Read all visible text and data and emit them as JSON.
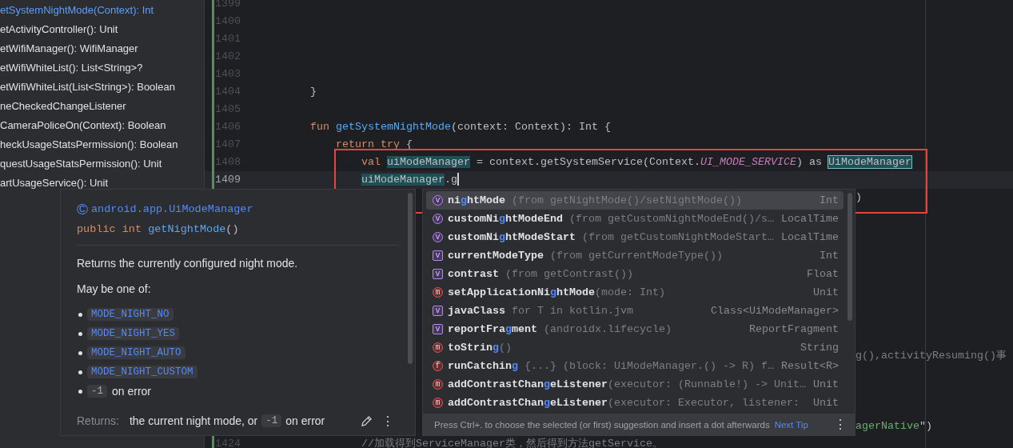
{
  "structure": {
    "items": [
      {
        "label": "etSystemNightMode(Context): Int",
        "selected": true
      },
      {
        "label": "etActivityController(): Unit",
        "selected": false
      },
      {
        "label": "etWifiManager(): WifiManager",
        "selected": false
      },
      {
        "label": "etWifiWhiteList(): List<String>?",
        "selected": false
      },
      {
        "label": "etWifiWhiteList(List<String>): Boolean",
        "selected": false
      },
      {
        "label": "neCheckedChangeListener",
        "selected": false
      },
      {
        "label": "CameraPoliceOn(Context): Boolean",
        "selected": false
      },
      {
        "label": "heckUsageStatsPermission(): Boolean",
        "selected": false
      },
      {
        "label": "questUsageStatsPermission(): Unit",
        "selected": false
      },
      {
        "label": "artUsageService(): Unit",
        "selected": false
      }
    ]
  },
  "editor": {
    "lines": [
      {
        "kind": "member",
        "num": "1399"
      },
      {
        "kind": "member",
        "num": "1400"
      },
      {
        "kind": "member",
        "num": "1401"
      },
      {
        "kind": "member",
        "num": "1402"
      },
      {
        "kind": "member",
        "num": "1403"
      },
      {
        "kind": "member",
        "num": "1404",
        "tokens": [
          {
            "text": "}",
            "kind": "plain"
          }
        ]
      },
      {
        "kind": "member",
        "num": "1405"
      },
      {
        "kind": "member",
        "num": "1406",
        "tokens": [
          {
            "text": "fun ",
            "kind": "kw"
          },
          {
            "text": "getSystemNightMode",
            "kind": "fn"
          },
          {
            "text": "(context: Context): Int {",
            "kind": "plain"
          }
        ]
      },
      {
        "kind": "body",
        "num": "1407",
        "tokens": [
          {
            "text": "return try",
            "kind": "kw"
          },
          {
            "text": " {",
            "kind": "plain"
          }
        ]
      },
      {
        "kind": "nested",
        "num": "1408",
        "tokens": [
          {
            "text": "val ",
            "kind": "kw"
          },
          {
            "text": "uiModeManager",
            "kind": "hl"
          },
          {
            "text": " = context.getSystemService(Context.",
            "kind": "plain"
          },
          {
            "text": "UI_MODE_SERVICE",
            "kind": "const"
          },
          {
            "text": ") as ",
            "kind": "plain"
          },
          {
            "text": "UiModeManager",
            "kind": "hlbox"
          }
        ]
      },
      {
        "kind": "nested",
        "num": "1409",
        "caret": true,
        "tokens": [
          {
            "text": "uiModeManager",
            "kind": "hl"
          },
          {
            "text": ".g",
            "kind": "plain"
          }
        ]
      },
      {
        "kind": "tail",
        "tokens": [
          {
            "text": ")",
            "kind": "plain"
          }
        ]
      },
      {
        "kind": "tail"
      },
      {
        "kind": "tail"
      },
      {
        "kind": "tail"
      },
      {
        "kind": "tail"
      },
      {
        "kind": "tail"
      },
      {
        "kind": "tail"
      },
      {
        "kind": "tail"
      },
      {
        "kind": "tail"
      },
      {
        "kind": "tail",
        "tokens": [
          {
            "text": "g(),activityResuming()事",
            "kind": "comment"
          }
        ]
      },
      {
        "kind": "tail"
      },
      {
        "kind": "tail"
      },
      {
        "kind": "tail"
      },
      {
        "kind": "tail",
        "tokens": [
          {
            "text": "agerNative",
            "kind": "string"
          },
          {
            "text": "\")",
            "kind": "plain"
          }
        ]
      },
      {
        "kind": "nested",
        "num": "1424",
        "tokens": [
          {
            "text": "//加载得到ServiceManager类，然后得到方法getService。",
            "kind": "comment"
          }
        ]
      }
    ]
  },
  "doc_popup": {
    "class_icon": "©",
    "class_name": "android.app.UiModeManager",
    "signature": [
      {
        "text": "public int ",
        "kind": "kw"
      },
      {
        "text": "getNightMode",
        "kind": "fn"
      },
      {
        "text": "()",
        "kind": "plain"
      }
    ],
    "description": "Returns the currently configured night mode.",
    "intro": "May be one of:",
    "values": [
      {
        "kind": "constant",
        "code": "MODE_NIGHT_NO"
      },
      {
        "kind": "constant",
        "code": "MODE_NIGHT_YES"
      },
      {
        "kind": "constant",
        "code": "MODE_NIGHT_AUTO"
      },
      {
        "kind": "constant",
        "code": "MODE_NIGHT_CUSTOM"
      },
      {
        "kind": "literal",
        "code": "-1",
        "text": "on error"
      }
    ],
    "returns_label": "Returns:",
    "returns_before": "the current night mode, or",
    "returns_code": "-1",
    "returns_after": "on error",
    "menu": "⋮"
  },
  "completion": {
    "items": [
      {
        "kind": "property",
        "icon_letter": "v",
        "name_parts": [
          "ni",
          "g",
          "htMode"
        ],
        "detail": " (from getNightMode()/setNightMode())",
        "type": "Int",
        "selected": true
      },
      {
        "kind": "property",
        "icon_letter": "v",
        "name_parts": [
          "customNi",
          "g",
          "htModeEnd"
        ],
        "detail": " (from getCustomNightModeEnd()/s…",
        "type": "LocalTime",
        "selected": false
      },
      {
        "kind": "property",
        "icon_letter": "v",
        "name_parts": [
          "customNi",
          "g",
          "htModeStart"
        ],
        "detail": " (from getCustomNightModeStart…",
        "type": "LocalTime",
        "selected": false
      },
      {
        "kind": "field",
        "icon_letter": "v",
        "name_parts": [
          "currentModeType"
        ],
        "detail": " (from getCurrentModeType())",
        "type": "Int",
        "selected": false
      },
      {
        "kind": "field",
        "icon_letter": "v",
        "name_parts": [
          "contrast"
        ],
        "detail": " (from getContrast())",
        "type": "Float",
        "selected": false
      },
      {
        "kind": "method",
        "icon_letter": "m",
        "name_parts": [
          "setApplicationNi",
          "g",
          "htMode"
        ],
        "detail": "(mode: Int)",
        "type": "Unit",
        "selected": false
      },
      {
        "kind": "field",
        "icon_letter": "v",
        "name_parts": [
          "javaClass"
        ],
        "detail": " for T in kotlin.jvm",
        "type": "Class<UiModeManager>",
        "selected": false
      },
      {
        "kind": "field",
        "icon_letter": "v",
        "name_parts": [
          "reportFra",
          "g",
          "ment"
        ],
        "detail": " (androidx.lifecycle)",
        "type": "ReportFragment",
        "selected": false
      },
      {
        "kind": "method",
        "icon_letter": "m",
        "name_parts": [
          "toStrin",
          "g"
        ],
        "detail": "()",
        "type": "String",
        "selected": false
      },
      {
        "kind": "function",
        "icon_letter": "f",
        "name_parts": [
          "runCatchin",
          "g"
        ],
        "detail": " {...} (block: UiModeManager.() -> R) f…",
        "type": "Result<R>",
        "selected": false
      },
      {
        "kind": "method",
        "icon_letter": "m",
        "name_parts": [
          "addContrastChan",
          "g",
          "eListener"
        ],
        "detail": "(executor: (Runnable!) -> Unit…",
        "type": "Unit",
        "selected": false
      },
      {
        "kind": "method",
        "icon_letter": "m",
        "name_parts": [
          "addContrastChan",
          "g",
          "eListener"
        ],
        "detail": "(executor: Executor, listener: ",
        "type": "Unit",
        "selected": false
      }
    ],
    "hint": "Press Ctrl+. to choose the selected (or first) suggestion and insert a dot afterwards",
    "hint_link": "Next Tip",
    "menu": "⋮"
  }
}
